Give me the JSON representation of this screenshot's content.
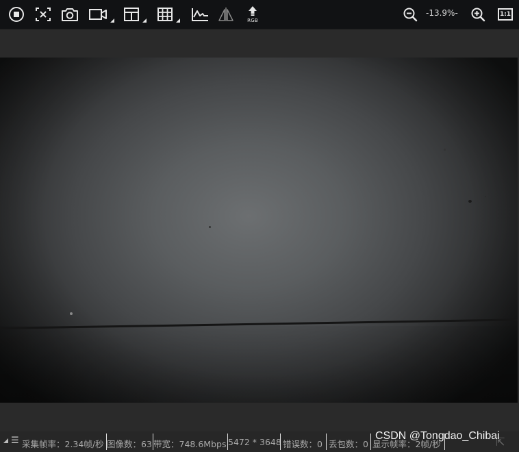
{
  "toolbar": {
    "buttons": [
      {
        "name": "stop-button",
        "icon": "stop-circle-icon"
      },
      {
        "name": "fit-window-button",
        "icon": "fit-screen-icon"
      },
      {
        "name": "snapshot-button",
        "icon": "camera-icon"
      },
      {
        "name": "record-button",
        "icon": "video-camera-icon"
      },
      {
        "name": "crosshair-grid-button",
        "icon": "grid-crosshair-icon"
      },
      {
        "name": "grid-button",
        "icon": "grid-icon"
      },
      {
        "name": "histogram-button",
        "icon": "chart-line-icon"
      },
      {
        "name": "mirror-button",
        "icon": "mirror-triangle-icon"
      },
      {
        "name": "rgb-button",
        "icon": "upload-arrow-icon"
      }
    ],
    "rgb_label": "RGB",
    "zoom_value": "-13.9%-",
    "zoom_out_icon": "zoom-out-icon",
    "zoom_in_icon": "zoom-in-icon",
    "actual_size_label": "1:1"
  },
  "statusbar": {
    "menu_icon": "hamburger-menu-icon",
    "items": [
      "采集帧率：2.34帧/秒",
      "图像数：63",
      "带宽：748.6Mbps",
      "5472 * 3648",
      "错误数：0",
      "丢包数：0",
      "显示帧率：2帧/秒"
    ]
  },
  "watermark": "CSDN @Tongdao_Chibai",
  "colors": {
    "toolbar_bg": "#111214",
    "panel_bg": "#2a2a2a",
    "status_text": "#a9a9a9"
  }
}
